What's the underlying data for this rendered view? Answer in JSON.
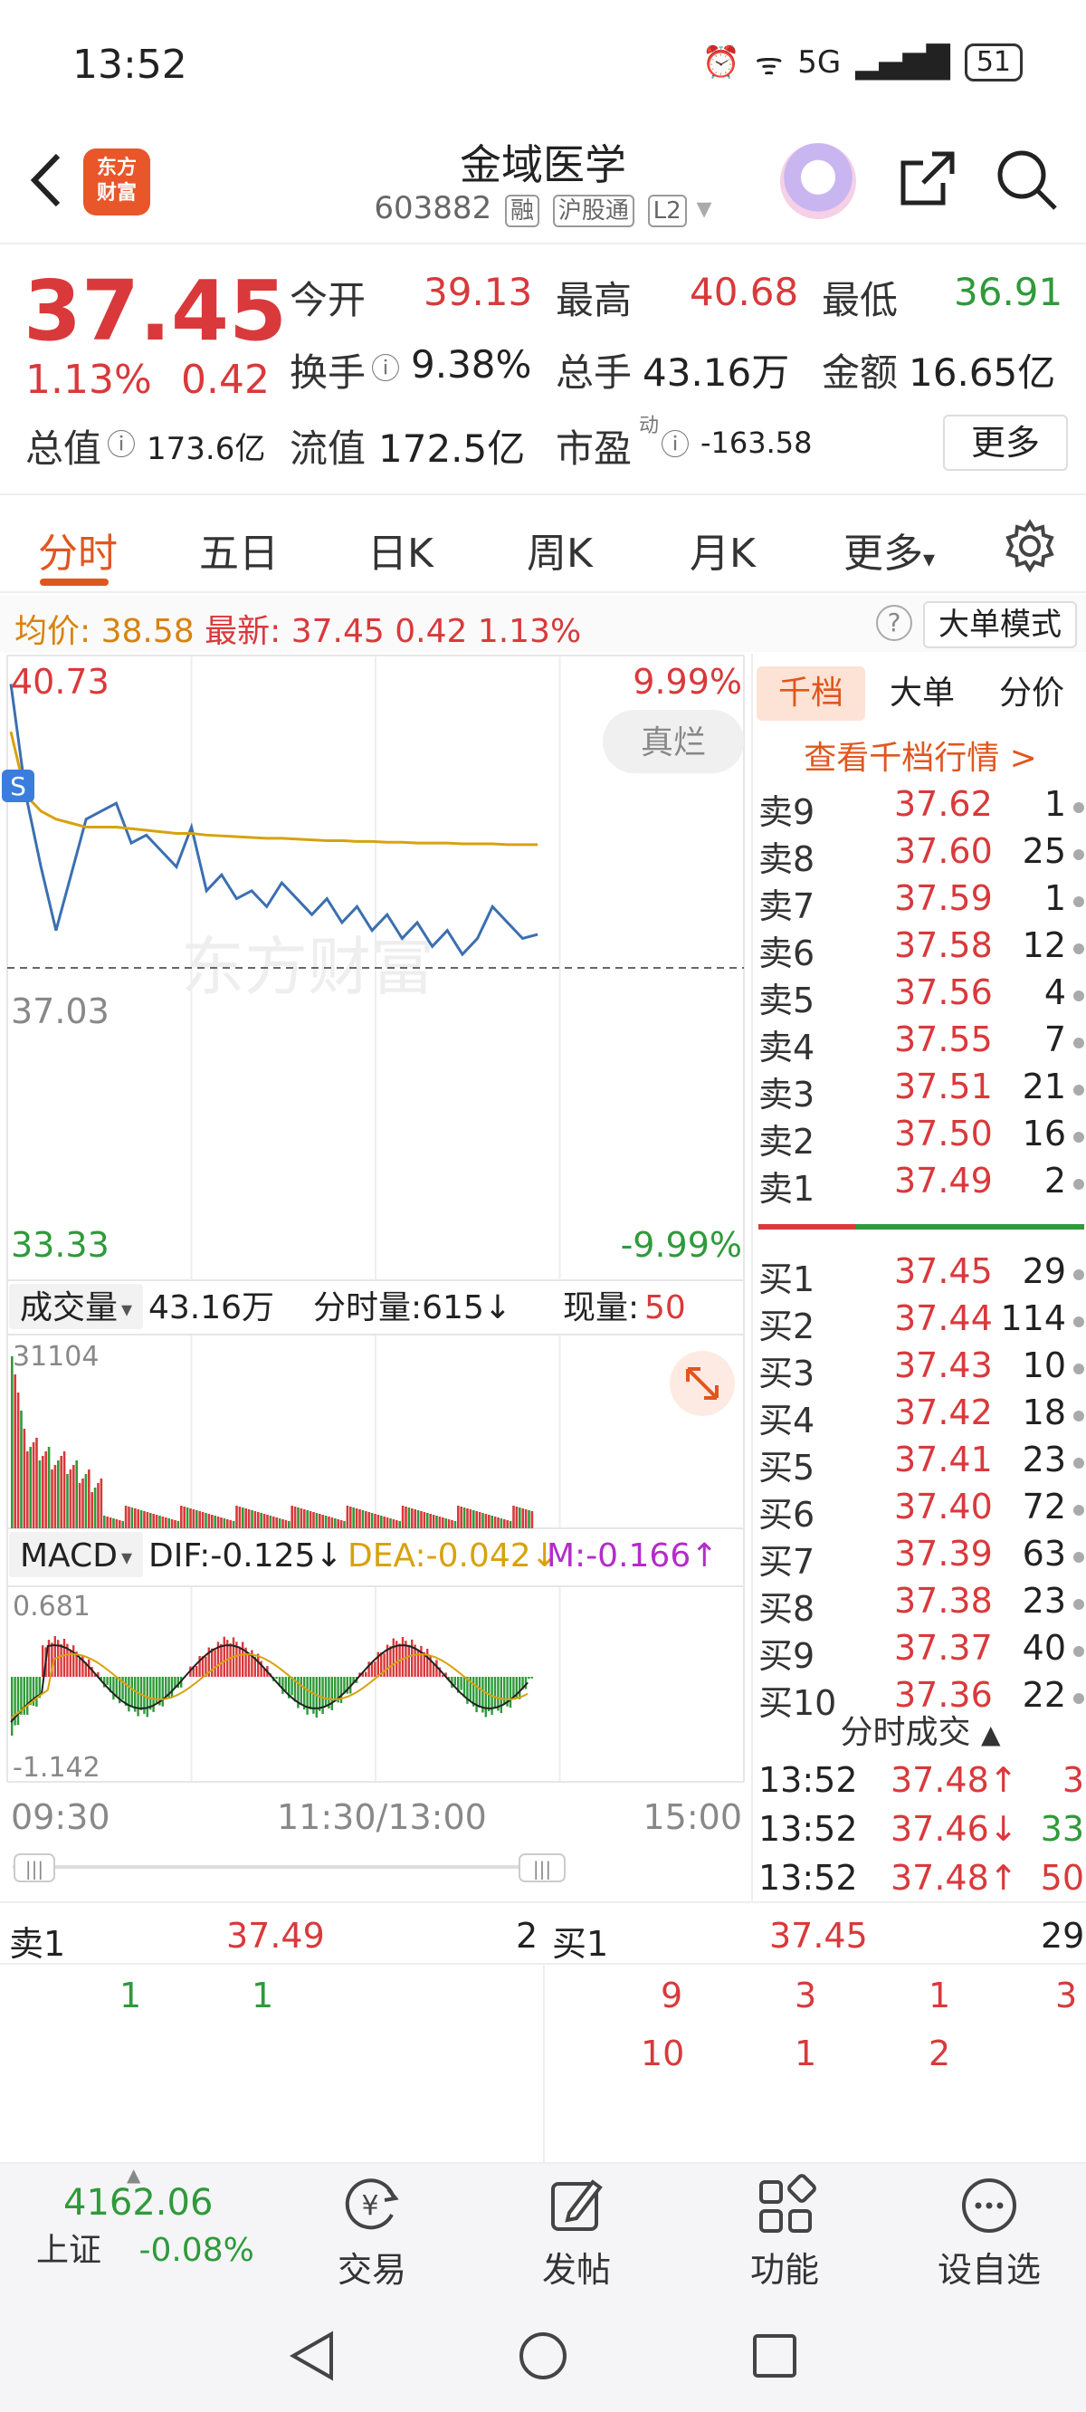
{
  "status_bar": {
    "time": "13:52",
    "network": "5G",
    "battery": "51"
  },
  "header": {
    "back_icon": "back-arrow-icon",
    "logo_text": [
      "东方",
      "财富"
    ],
    "stock_name": "金域医学",
    "stock_code": "603882",
    "tags": [
      "融",
      "沪股通",
      "L2"
    ],
    "share_icon": "share-icon",
    "search_icon": "search-icon"
  },
  "quote": {
    "price": "37.45",
    "change_pct": "1.13%",
    "change_amt": "0.42",
    "open_label": "今开",
    "open": "39.13",
    "high_label": "最高",
    "high": "40.68",
    "low_label": "最低",
    "low": "36.91",
    "turnover_label": "换手",
    "turnover": "9.38%",
    "volume_label": "总手",
    "volume": "43.16万",
    "amount_label": "金额",
    "amount": "16.65亿",
    "mktcap_label": "总值",
    "mktcap": "173.6亿",
    "float_label": "流值",
    "float": "172.5亿",
    "pe_label": "市盈",
    "pe_sup": "动",
    "pe": "-163.58",
    "more_label": "更多"
  },
  "tabs": [
    "分时",
    "五日",
    "日K",
    "周K",
    "月K",
    "更多"
  ],
  "avg_line": {
    "avg_label": "均价:",
    "avg": "38.58",
    "latest_label": "最新:",
    "latest": "37.45",
    "chg": "0.42",
    "pct": "1.13%",
    "mode_label": "大单模式"
  },
  "chart": {
    "price_high": "40.73",
    "price_low": "33.33",
    "pct_high": "9.99%",
    "pct_low": "-9.99%",
    "prev_close": "37.03",
    "badge": "真烂",
    "watermark": "东方财富",
    "volume_label": "成交量",
    "volume_total": "43.16万",
    "tick_vol_label": "分时量:615↓",
    "cur_vol_label": "现量:",
    "cur_vol": "50",
    "vol_max": "31104",
    "macd_label": "MACD",
    "dif": "DIF:-0.125↓",
    "dea": "DEA:-0.042↓",
    "m": "M:-0.166↑",
    "macd_high": "0.681",
    "macd_low": "-1.142",
    "time_start": "09:30",
    "time_mid": "11:30/13:00",
    "time_end": "15:00"
  },
  "chart_data": {
    "type": "line",
    "x": [
      "09:30",
      "09:35",
      "09:40",
      "09:45",
      "09:50",
      "09:55",
      "10:00",
      "10:05",
      "10:10",
      "10:15",
      "10:20",
      "10:25",
      "10:30",
      "10:35",
      "10:40",
      "10:45",
      "10:50",
      "10:55",
      "11:00",
      "11:05",
      "11:10",
      "11:15",
      "11:20",
      "11:25",
      "11:30",
      "13:05",
      "13:10",
      "13:15",
      "13:20",
      "13:25",
      "13:30",
      "13:35",
      "13:40",
      "13:45",
      "13:50",
      "13:52"
    ],
    "series": [
      {
        "values": [
          40.6,
          39.2,
          38.3,
          37.5,
          38.2,
          38.9,
          39.0,
          39.1,
          38.6,
          38.7,
          38.5,
          38.3,
          38.8,
          38.0,
          38.2,
          37.9,
          38.0,
          37.8,
          38.1,
          37.9,
          37.7,
          37.9,
          37.6,
          37.8,
          37.5,
          37.7,
          37.4,
          37.6,
          37.3,
          37.5,
          37.2,
          37.4,
          37.8,
          37.6,
          37.4,
          37.45
        ]
      },
      {
        "values": [
          40.0,
          39.2,
          39.0,
          38.9,
          38.85,
          38.8,
          38.8,
          38.8,
          38.78,
          38.76,
          38.74,
          38.72,
          38.72,
          38.7,
          38.69,
          38.68,
          38.67,
          38.66,
          38.66,
          38.65,
          38.64,
          38.63,
          38.63,
          38.62,
          38.62,
          38.61,
          38.61,
          38.6,
          38.6,
          38.6,
          38.59,
          38.59,
          38.59,
          38.58,
          38.58,
          38.58
        ]
      }
    ],
    "ylim": [
      33.33,
      40.73
    ]
  },
  "order_book": {
    "tabs": [
      "千档",
      "大单",
      "分价"
    ],
    "link": "查看千档行情 >",
    "asks": [
      {
        "label": "卖9",
        "price": "37.62",
        "vol": "1"
      },
      {
        "label": "卖8",
        "price": "37.60",
        "vol": "25"
      },
      {
        "label": "卖7",
        "price": "37.59",
        "vol": "1"
      },
      {
        "label": "卖6",
        "price": "37.58",
        "vol": "12"
      },
      {
        "label": "卖5",
        "price": "37.56",
        "vol": "4"
      },
      {
        "label": "卖4",
        "price": "37.55",
        "vol": "7"
      },
      {
        "label": "卖3",
        "price": "37.51",
        "vol": "21"
      },
      {
        "label": "卖2",
        "price": "37.50",
        "vol": "16"
      },
      {
        "label": "卖1",
        "price": "37.49",
        "vol": "2"
      }
    ],
    "bids": [
      {
        "label": "买1",
        "price": "37.45",
        "vol": "29"
      },
      {
        "label": "买2",
        "price": "37.44",
        "vol": "114"
      },
      {
        "label": "买3",
        "price": "37.43",
        "vol": "10"
      },
      {
        "label": "买4",
        "price": "37.42",
        "vol": "18"
      },
      {
        "label": "买5",
        "price": "37.41",
        "vol": "23"
      },
      {
        "label": "买6",
        "price": "37.40",
        "vol": "72"
      },
      {
        "label": "买7",
        "price": "37.39",
        "vol": "63"
      },
      {
        "label": "买8",
        "price": "37.38",
        "vol": "23"
      },
      {
        "label": "买9",
        "price": "37.37",
        "vol": "40"
      },
      {
        "label": "买10",
        "price": "37.36",
        "vol": "22"
      }
    ],
    "trades_title": "分时成交",
    "trades": [
      {
        "time": "13:52",
        "price": "37.48↑",
        "vol": "3",
        "dir": "up"
      },
      {
        "time": "13:52",
        "price": "37.46↓",
        "vol": "33",
        "dir": "down"
      },
      {
        "time": "13:52",
        "price": "37.48↑",
        "vol": "50",
        "dir": "up"
      }
    ]
  },
  "queue": {
    "sell_label": "卖1",
    "sell_price": "37.49",
    "sell_vol": "2",
    "buy_label": "买1",
    "buy_price": "37.45",
    "buy_vol": "29",
    "sell_orders": [
      "1",
      "1"
    ],
    "buy_orders_row1": [
      "9",
      "3",
      "1",
      "3"
    ],
    "buy_orders_row2": [
      "10",
      "1",
      "2"
    ]
  },
  "bottom_nav": {
    "index_value": "4162.06",
    "index_name": "上证",
    "index_chg": "-0.08%",
    "items": [
      {
        "label": "交易",
        "icon": "trade-icon"
      },
      {
        "label": "发帖",
        "icon": "post-icon"
      },
      {
        "label": "功能",
        "icon": "apps-icon"
      },
      {
        "label": "设自选",
        "icon": "more-icon"
      }
    ]
  }
}
